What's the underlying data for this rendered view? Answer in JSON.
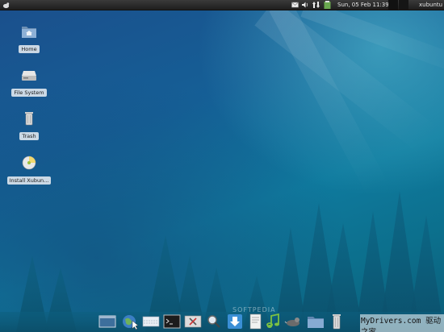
{
  "top_panel": {
    "clock": "Sun, 05 Feb  11:39",
    "user": "xubuntu",
    "tray_icons": [
      "mail-icon",
      "volume-icon",
      "network-icon",
      "clipboard-icon"
    ]
  },
  "desktop": {
    "icons": [
      {
        "name": "home-folder-icon",
        "label": "Home"
      },
      {
        "name": "file-system-icon",
        "label": "File System"
      },
      {
        "name": "trash-icon",
        "label": "Trash"
      },
      {
        "name": "install-disc-icon",
        "label": "Install Xubun..."
      }
    ]
  },
  "dock": {
    "items": [
      "show-desktop-icon",
      "web-browser-icon",
      "window-switcher-icon",
      "terminal-icon",
      "settings-icon",
      "search-icon",
      "download-icon",
      "text-editor-icon",
      "media-player-icon",
      "mail-client-icon",
      "file-manager-icon",
      "trash-icon"
    ]
  },
  "watermarks": {
    "softpedia": "SOFTPEDIA",
    "mydrivers": "MyDrivers.com 驱动之家"
  },
  "colors": {
    "panel": "#262626",
    "wallpaper_top": "#1b4f8c",
    "wallpaper_mid": "#0f7a9e"
  }
}
